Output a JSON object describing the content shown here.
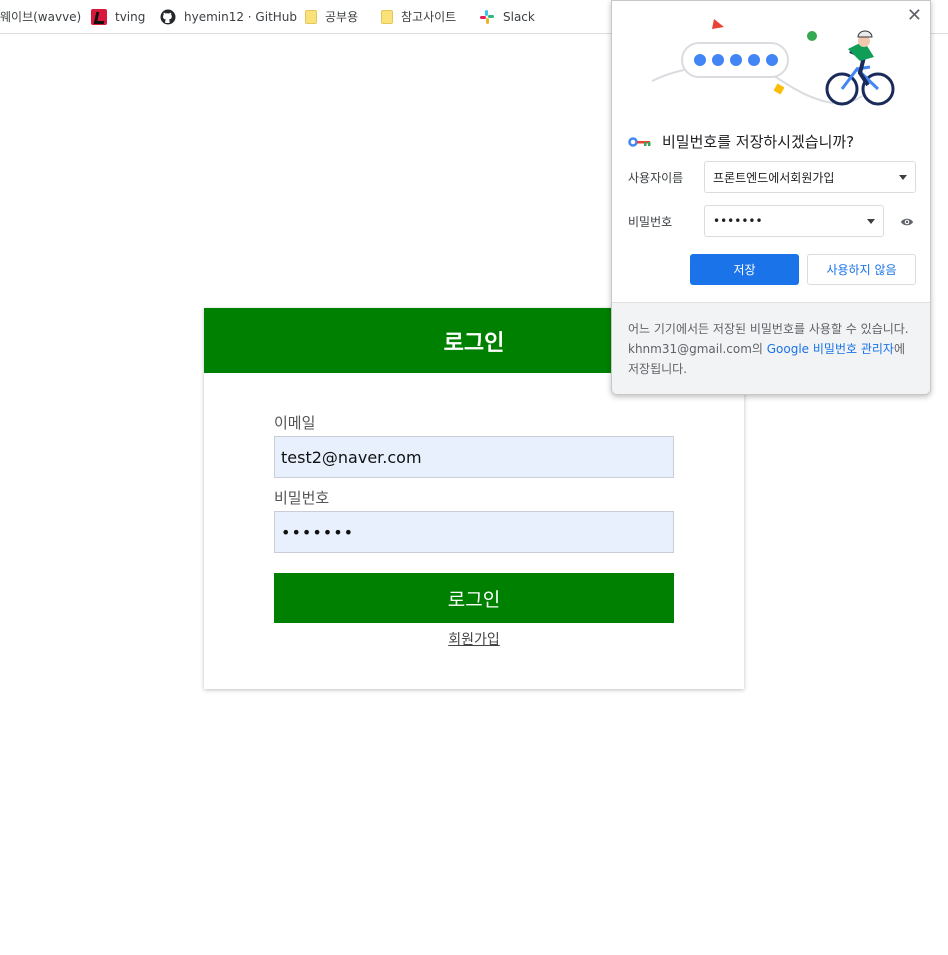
{
  "bookmarks": [
    {
      "label": "웨이브(wavve)",
      "icon": "wavve-icon"
    },
    {
      "label": "tving",
      "icon": "tving-icon"
    },
    {
      "label": "hyemin12 · GitHub",
      "icon": "github-icon"
    },
    {
      "label": "공부용",
      "icon": "folder-icon"
    },
    {
      "label": "참고사이트",
      "icon": "folder-icon"
    },
    {
      "label": "Slack",
      "icon": "slack-icon"
    }
  ],
  "login": {
    "header": "로그인",
    "email_label": "이메일",
    "email_value": "test2@naver.com",
    "password_label": "비밀번호",
    "password_value": "•••••••",
    "submit_label": "로그인",
    "signup_link": "회원가입",
    "accent": "#008000"
  },
  "save_popup": {
    "title": "비밀번호를 저장하시겠습니까?",
    "username_label": "사용자이름",
    "username_value": "프론트엔드에서회원가입",
    "password_label": "비밀번호",
    "password_value": "•••••••",
    "save_label": "저장",
    "never_label": "사용하지 않음",
    "footer_before": "어느 기기에서든 저장된 비밀번호를 사용할 수 있습니다. khnm31@gmail.com의 ",
    "footer_link": "Google 비밀번호 관리자",
    "footer_after": "에 저장됩니다.",
    "close_symbol": "✕",
    "accent": "#1a73e8"
  }
}
